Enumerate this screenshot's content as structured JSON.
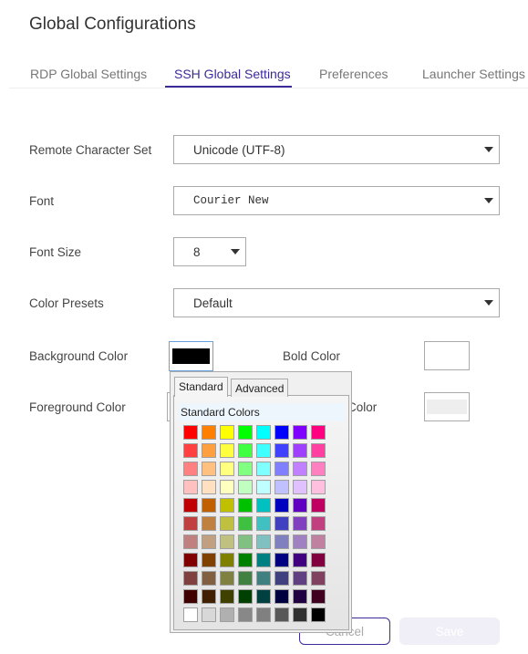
{
  "title": "Global Configurations",
  "tabs": [
    {
      "label": "RDP Global Settings"
    },
    {
      "label": "SSH Global Settings",
      "active": true
    },
    {
      "label": "Preferences"
    },
    {
      "label": "Launcher Settings"
    }
  ],
  "form": {
    "charset": {
      "label": "Remote Character Set",
      "value": "Unicode (UTF-8)"
    },
    "font": {
      "label": "Font",
      "value": "Courier New"
    },
    "font_size": {
      "label": "Font Size",
      "value": "8"
    },
    "presets": {
      "label": "Color Presets",
      "value": "Default"
    },
    "background": {
      "label": "Background Color",
      "color": "#000000"
    },
    "bold": {
      "label": "Bold Color",
      "color": "#ffffff"
    },
    "foreground": {
      "label": "Foreground Color"
    },
    "hidden_label": "Color"
  },
  "picker": {
    "tabs": [
      "Standard",
      "Advanced"
    ],
    "active_tab": "Standard",
    "header": "Standard Colors",
    "colors": [
      [
        "#FF0000",
        "#FF8000",
        "#FFFF00",
        "#00FF00",
        "#00FFFF",
        "#0000FF",
        "#8000FF",
        "#FF0080"
      ],
      [
        "#FF4040",
        "#FFA040",
        "#FFFF40",
        "#40FF40",
        "#40FFFF",
        "#4040FF",
        "#A040FF",
        "#FF40A0"
      ],
      [
        "#FF8080",
        "#FFC080",
        "#FFFF80",
        "#80FF80",
        "#80FFFF",
        "#8080FF",
        "#C080FF",
        "#FF80C0"
      ],
      [
        "#FFC0C0",
        "#FFE0C0",
        "#FFFFC0",
        "#C0FFC0",
        "#C0FFFF",
        "#C0C0FF",
        "#E0C0FF",
        "#FFC0E0"
      ],
      [
        "#C00000",
        "#C06000",
        "#C0C000",
        "#00C000",
        "#00C0C0",
        "#0000C0",
        "#6000C0",
        "#C00060"
      ],
      [
        "#C04040",
        "#C08040",
        "#C0C040",
        "#40C040",
        "#40C0C0",
        "#4040C0",
        "#8040C0",
        "#C04080"
      ],
      [
        "#C08080",
        "#C0A080",
        "#C0C080",
        "#80C080",
        "#80C0C0",
        "#8080C0",
        "#A080C0",
        "#C080A0"
      ],
      [
        "#800000",
        "#804000",
        "#808000",
        "#008000",
        "#008080",
        "#000080",
        "#400080",
        "#800040"
      ],
      [
        "#804040",
        "#806040",
        "#808040",
        "#408040",
        "#408080",
        "#404080",
        "#604080",
        "#804060"
      ],
      [
        "#400000",
        "#402000",
        "#404000",
        "#004000",
        "#004040",
        "#000040",
        "#200040",
        "#400020"
      ],
      [
        "#FFFFFF",
        "#D8D8D8",
        "#B0B0B0",
        "#888888",
        "#808080",
        "#585858",
        "#303030",
        "#000000"
      ]
    ]
  },
  "buttons": {
    "cancel": "Cancel",
    "save": "Save"
  },
  "accent": "#3b2b9a"
}
